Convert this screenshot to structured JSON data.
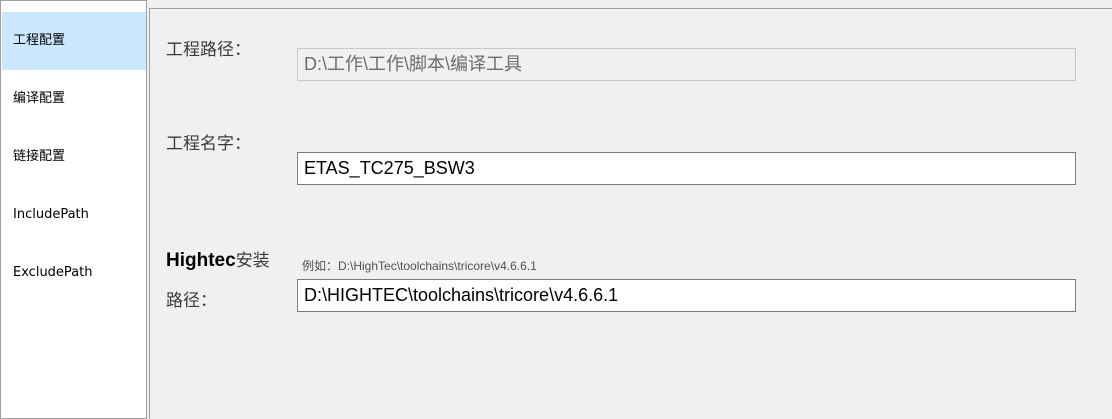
{
  "sidebar": {
    "items": [
      {
        "label": "工程配置"
      },
      {
        "label": "编译配置"
      },
      {
        "label": "链接配置"
      },
      {
        "label": "IncludePath"
      },
      {
        "label": "ExcludePath"
      }
    ]
  },
  "project_path": {
    "label": "工程路径：",
    "value": "D:\\工作\\工作\\脚本\\编译工具"
  },
  "project_name": {
    "label": "工程名字：",
    "value": "ETAS_TC275_BSW3"
  },
  "hightec": {
    "label_bold": "Hightec",
    "label_rest": "安装",
    "label_line2": "路径：",
    "example": "例如：D:\\HighTec\\toolchains\\tricore\\v4.6.6.1",
    "value": "D:\\HIGHTEC\\toolchains\\tricore\\v4.6.6.1"
  },
  "colors": {
    "selected_item": "#cce8ff",
    "panel_bg": "#f0f0f0"
  }
}
